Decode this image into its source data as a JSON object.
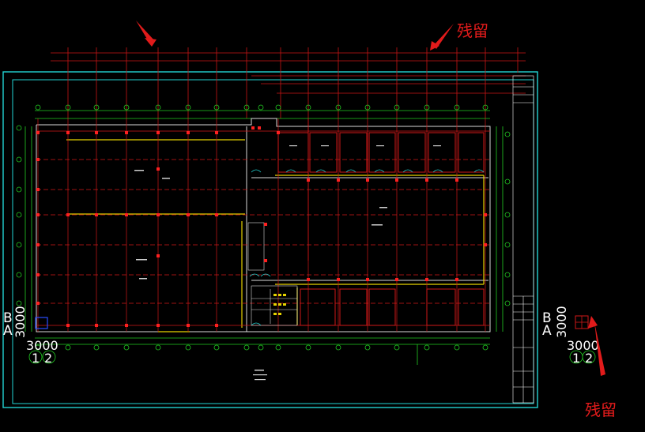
{
  "annotations": {
    "residual_top": "残留",
    "residual_bottom_right": "残留"
  },
  "left_marker": {
    "top_letter": "B",
    "bottom_letter": "A",
    "vertical_dim": "3000",
    "horizontal_dim": "3000",
    "axis_1": "1",
    "axis_2": "2"
  },
  "right_marker": {
    "top_letter": "B",
    "bottom_letter": "A",
    "vertical_dim": "3000",
    "horizontal_dim": "3000",
    "axis_1": "1",
    "axis_2": "2"
  },
  "colors": {
    "background": "#000000",
    "frame_cyan": "#22d3d3",
    "grid_red": "#d01818",
    "wall_yellow": "#e6d200",
    "axis_green": "#22cc22",
    "annotation_red": "#e11b1b"
  }
}
